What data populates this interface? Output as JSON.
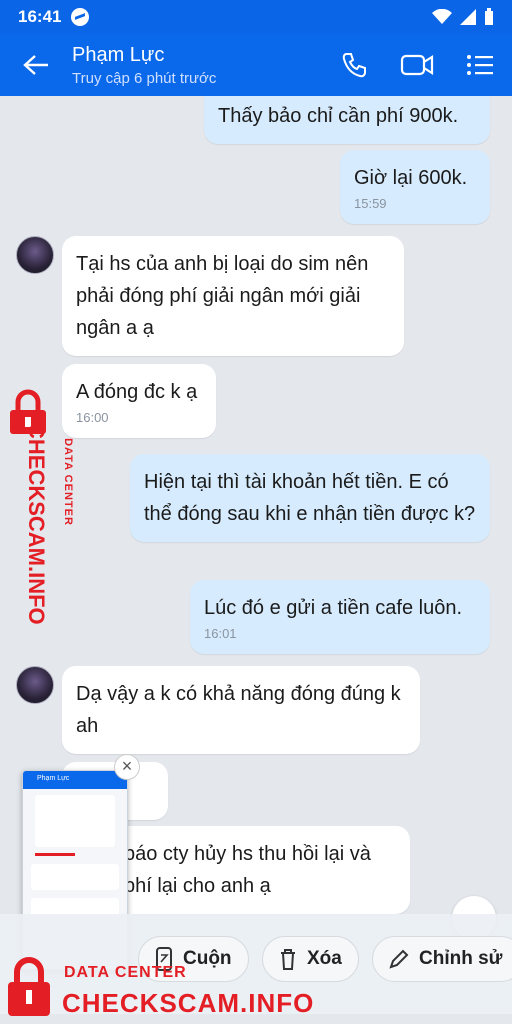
{
  "status": {
    "time": "16:41"
  },
  "header": {
    "name": "Phạm Lực",
    "subtitle": "Truy cập 6 phút trước"
  },
  "messages": {
    "m1": "Thấy bảo chỉ cần phí 900k.",
    "m2": "Giờ lại 600k.",
    "m2_time": "15:59",
    "m3": "Tại hs của anh bị loại do sim nên phải đóng phí giải ngân mới giải ngân a ạ",
    "m4": "A đóng đc k ạ",
    "m4_time": "16:00",
    "m5": "Hiện tại thì tài khoản hết tiền. E có thể đóng sau khi e nhận tiền được k?",
    "m6": "Lúc đó e gửi a tiền cafe luôn.",
    "m6_time": "16:01",
    "m7": "Dạ vậy a k có khả năng đóng đúng k ah",
    "m8": "báo cty hủy hs thu hồi lại và phí lại cho anh ạ"
  },
  "actions": {
    "scroll": "Cuộn",
    "delete": "Xóa",
    "edit": "Chỉnh sử"
  },
  "watermark": {
    "top": "DATA CENTER",
    "main": "CHECKSCAM.INFO"
  },
  "thumbnail": {
    "name": "Phạm Lực"
  }
}
